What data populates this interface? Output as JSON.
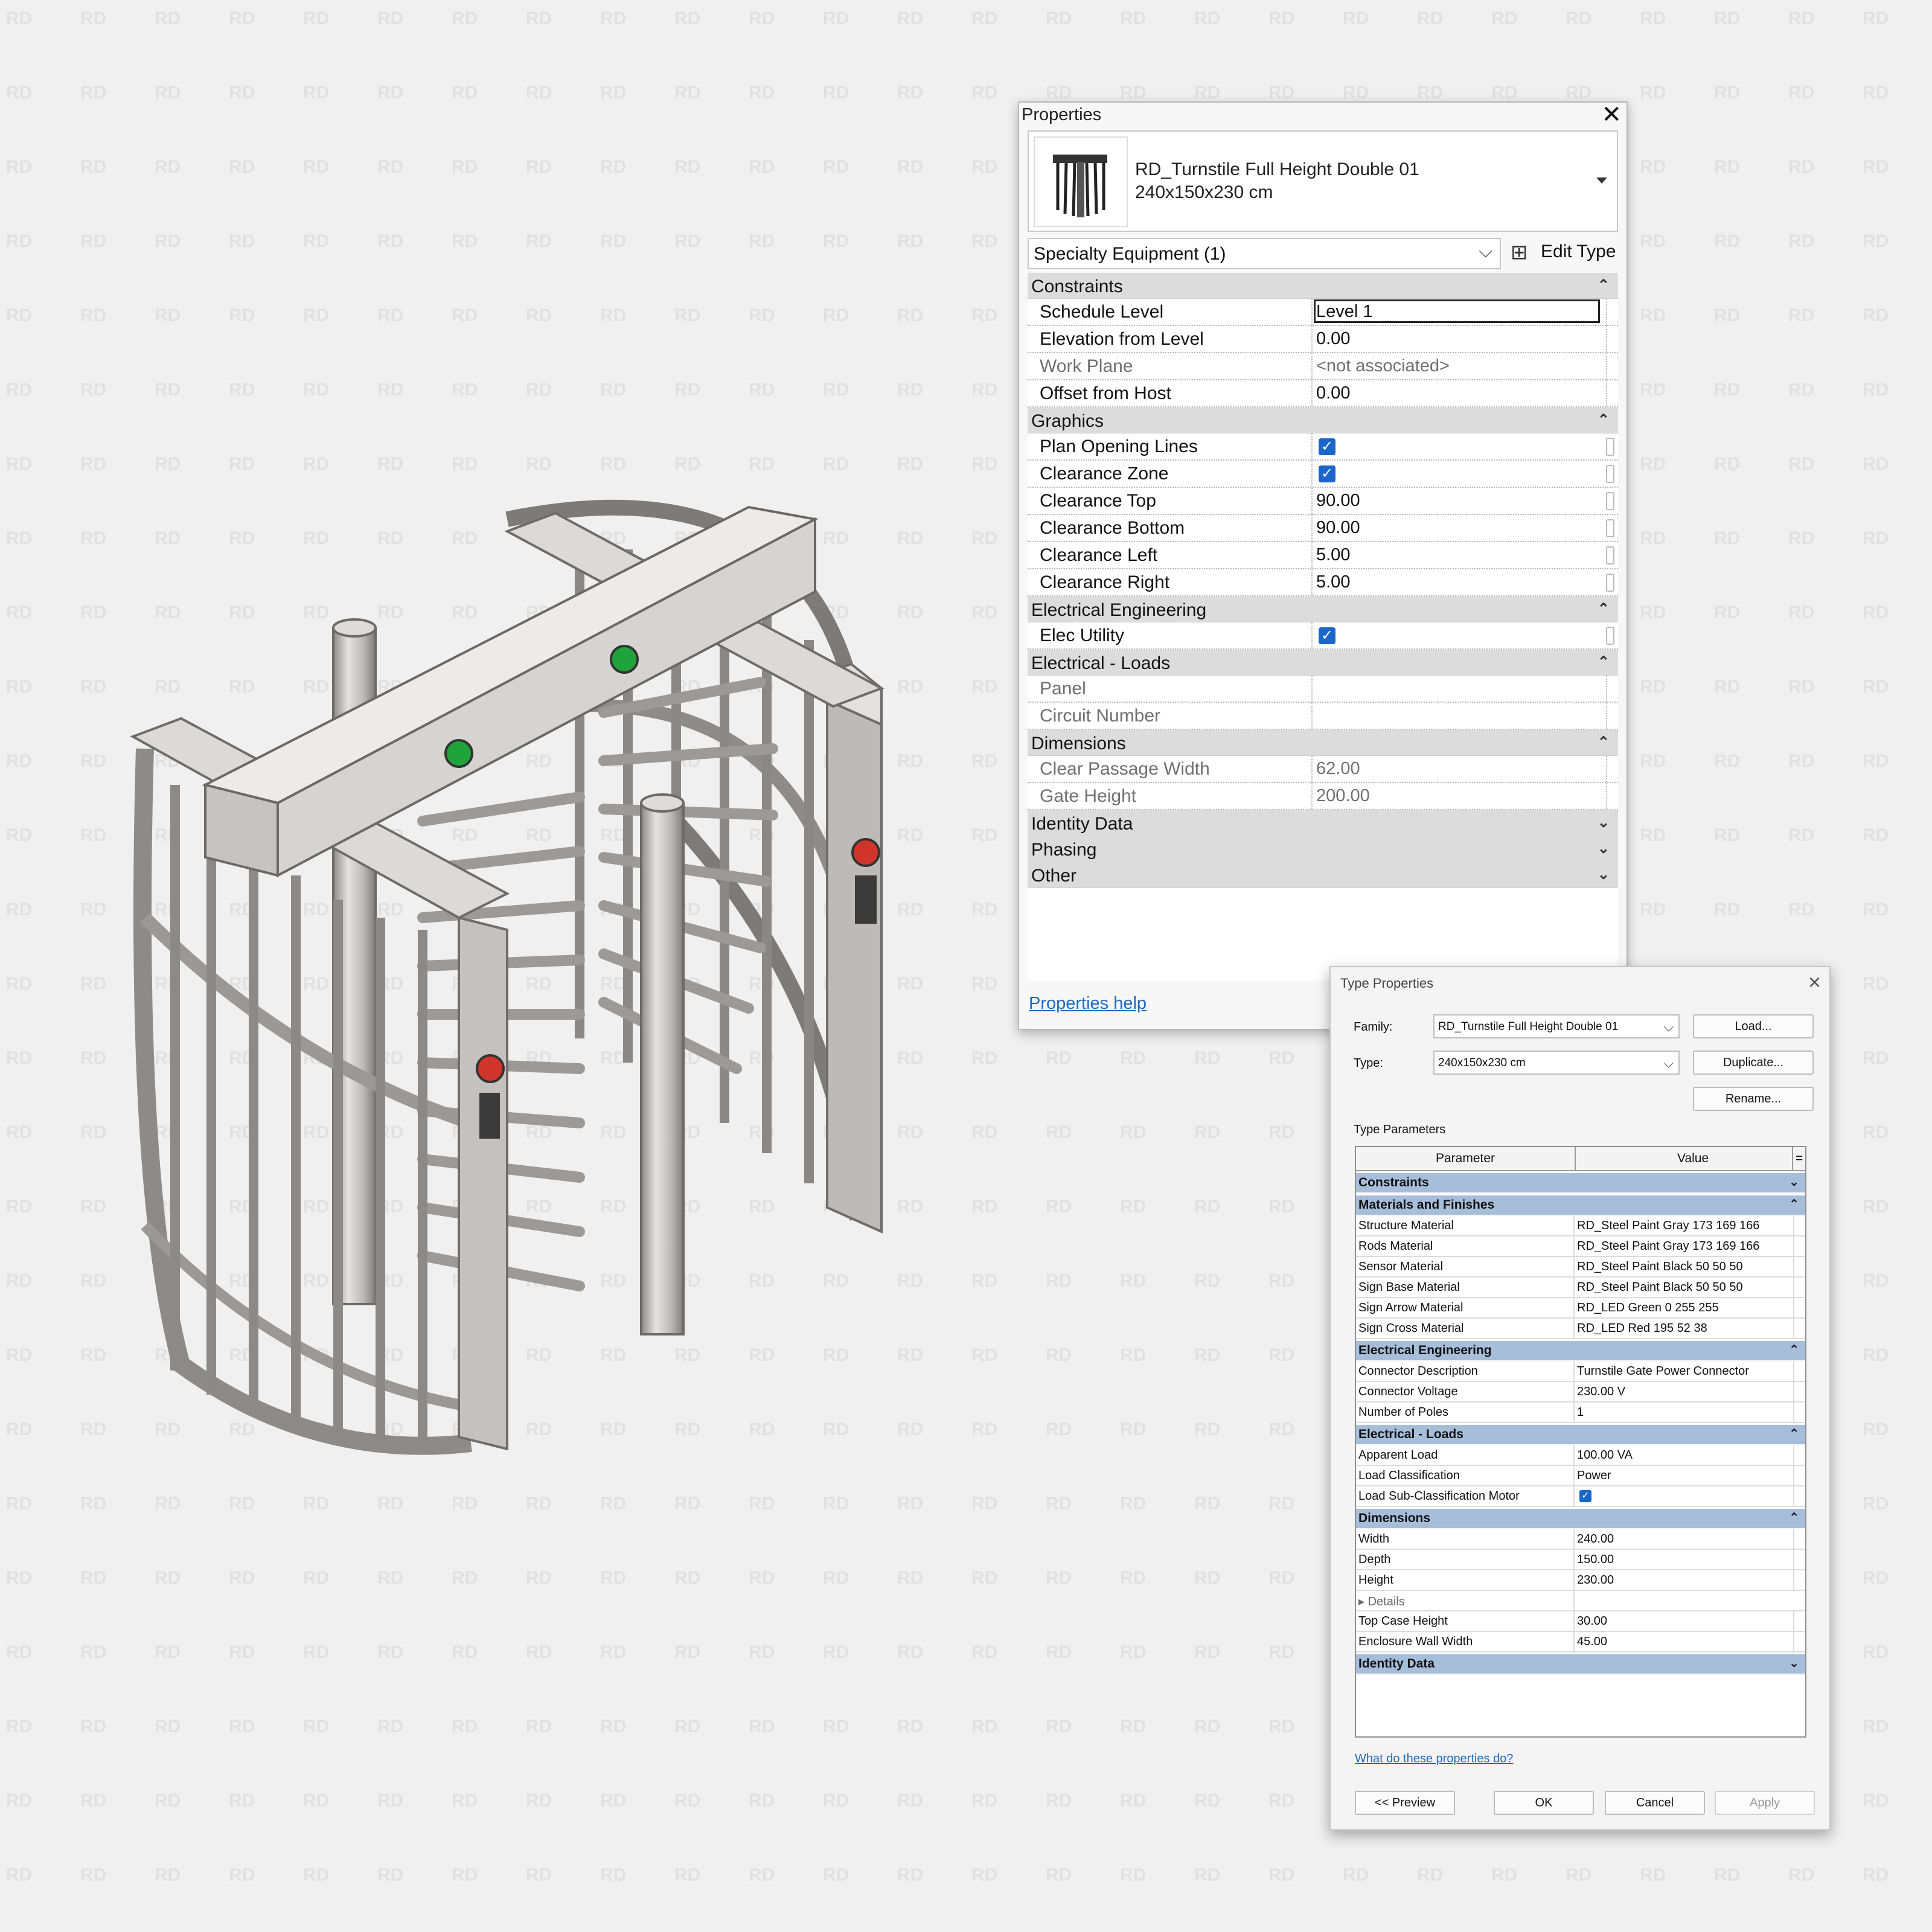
{
  "watermark": "RD",
  "properties": {
    "title": "Properties",
    "type_name": "RD_Turnstile Full Height Double 01",
    "type_size": "240x150x230 cm",
    "selector": "Specialty Equipment (1)",
    "edit_type": "Edit Type",
    "groups": {
      "constraints": {
        "label": "Constraints",
        "schedule_level": {
          "name": "Schedule Level",
          "value": "Level 1"
        },
        "elevation": {
          "name": "Elevation from Level",
          "value": "0.00"
        },
        "work_plane": {
          "name": "Work Plane",
          "value": "<not associated>"
        },
        "offset": {
          "name": "Offset from Host",
          "value": "0.00"
        }
      },
      "graphics": {
        "label": "Graphics",
        "plan_opening_lines": {
          "name": "Plan Opening Lines",
          "checked": true
        },
        "clearance_zone": {
          "name": "Clearance Zone",
          "checked": true
        },
        "clearance_top": {
          "name": "Clearance Top",
          "value": "90.00"
        },
        "clearance_bottom": {
          "name": "Clearance Bottom",
          "value": "90.00"
        },
        "clearance_left": {
          "name": "Clearance Left",
          "value": "5.00"
        },
        "clearance_right": {
          "name": "Clearance Right",
          "value": "5.00"
        }
      },
      "electrical_engineering": {
        "label": "Electrical Engineering",
        "elec_utility": {
          "name": "Elec Utility",
          "checked": true
        }
      },
      "electrical_loads": {
        "label": "Electrical - Loads",
        "panel": {
          "name": "Panel",
          "value": ""
        },
        "circuit_number": {
          "name": "Circuit Number",
          "value": ""
        }
      },
      "dimensions": {
        "label": "Dimensions",
        "clear_passage_width": {
          "name": "Clear Passage Width",
          "value": "62.00"
        },
        "gate_height": {
          "name": "Gate Height",
          "value": "200.00"
        }
      },
      "identity_data": {
        "label": "Identity Data"
      },
      "phasing": {
        "label": "Phasing"
      },
      "other": {
        "label": "Other"
      }
    },
    "help": "Properties help"
  },
  "type_properties": {
    "title": "Type Properties",
    "family_label": "Family:",
    "family_value": "RD_Turnstile Full Height Double 01",
    "type_label": "Type:",
    "type_value": "240x150x230 cm",
    "load": "Load...",
    "duplicate": "Duplicate...",
    "rename": "Rename...",
    "type_parameters": "Type Parameters",
    "col_parameter": "Parameter",
    "col_value": "Value",
    "col_equals": "=",
    "groups": {
      "constraints": {
        "label": "Constraints"
      },
      "materials": {
        "label": "Materials and Finishes",
        "structure": {
          "name": "Structure Material",
          "value": "RD_Steel Paint Gray 173 169 166"
        },
        "rods": {
          "name": "Rods Material",
          "value": "RD_Steel Paint Gray 173 169 166"
        },
        "sensor": {
          "name": "Sensor Material",
          "value": "RD_Steel Paint Black 50 50 50"
        },
        "sign_base": {
          "name": "Sign Base Material",
          "value": "RD_Steel Paint Black 50 50 50"
        },
        "sign_arrow": {
          "name": "Sign Arrow Material",
          "value": "RD_LED Green 0 255 255"
        },
        "sign_cross": {
          "name": "Sign Cross Material",
          "value": "RD_LED Red 195 52 38"
        }
      },
      "electrical_engineering": {
        "label": "Electrical Engineering",
        "connector_description": {
          "name": "Connector Description",
          "value": "Turnstile Gate Power Connector"
        },
        "connector_voltage": {
          "name": "Connector Voltage",
          "value": "230.00 V"
        },
        "number_of_poles": {
          "name": "Number of Poles",
          "value": "1"
        }
      },
      "electrical_loads": {
        "label": "Electrical - Loads",
        "apparent_load": {
          "name": "Apparent Load",
          "value": "100.00 VA"
        },
        "load_classification": {
          "name": "Load Classification",
          "value": "Power"
        },
        "load_sub_classification": {
          "name": "Load Sub-Classification Motor",
          "checked": true
        }
      },
      "dimensions": {
        "label": "Dimensions",
        "width": {
          "name": "Width",
          "value": "240.00"
        },
        "depth": {
          "name": "Depth",
          "value": "150.00"
        },
        "height": {
          "name": "Height",
          "value": "230.00"
        },
        "details": {
          "name": "▸ Details",
          "value": ""
        },
        "top_case_height": {
          "name": "Top Case Height",
          "value": "30.00"
        },
        "enclosure_wall_width": {
          "name": "Enclosure Wall Width",
          "value": "45.00"
        }
      },
      "identity_data": {
        "label": "Identity Data"
      }
    },
    "help": "What do these properties do?",
    "preview": "<< Preview",
    "ok": "OK",
    "cancel": "Cancel",
    "apply": "Apply"
  },
  "colors": {
    "background": "#f0f0f0",
    "steel": "#c9c7c4",
    "sign_arrow": "#1fa33a",
    "sign_cross": "#d1342a",
    "checkbox": "#1a66c9",
    "group_header_type": "#a7bedb"
  }
}
